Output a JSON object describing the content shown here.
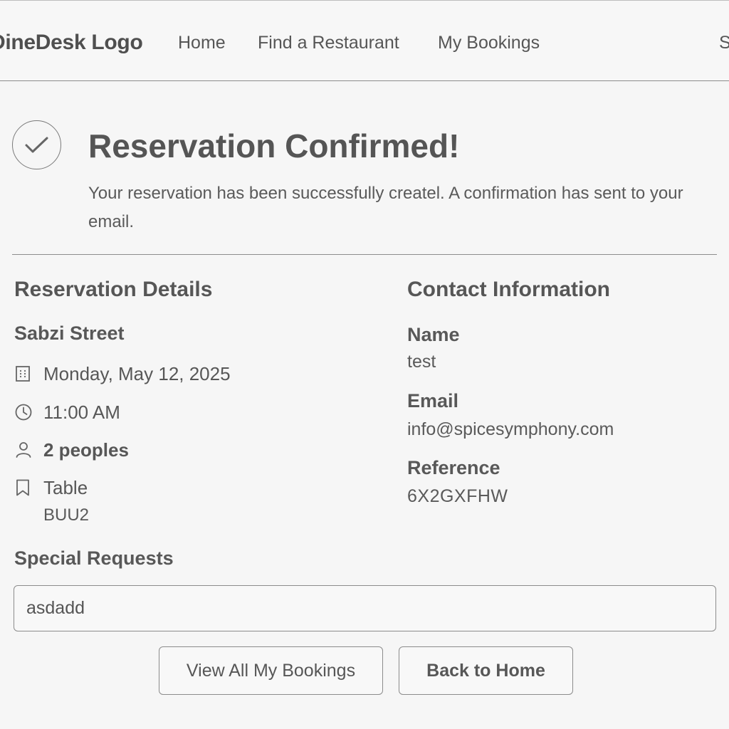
{
  "header": {
    "logo": "DineDesk Logo",
    "nav": {
      "home": "Home",
      "find": "Find a Restaurant",
      "bookings": "My Bookings",
      "edge_partial": "S"
    }
  },
  "confirmation": {
    "title": "Reservation Confirmed!",
    "message": "Your reservation has been successfully createl. A confirmation has sent to your email."
  },
  "reservation": {
    "heading": "Reservation Details",
    "restaurant": "Sabzi Street",
    "date": "Monday, May 12, 2025",
    "time": "11:00 AM",
    "party": "2 peoples",
    "table_label": "Table",
    "table_code": "BUU2"
  },
  "contact": {
    "heading": "Contact Information",
    "name_label": "Name",
    "name_value": "test",
    "email_label": "Email",
    "email_value": "info@spicesymphony.com",
    "reference_label": "Reference",
    "reference_value": "6X2GXFHW"
  },
  "special_requests": {
    "heading": "Special Requests",
    "value": "asdadd"
  },
  "actions": {
    "view_all": "View All My Bookings",
    "back_home": "Back to Home"
  },
  "icons": {
    "check": "check-icon",
    "calendar": "calendar-icon",
    "clock": "clock-icon",
    "person": "person-icon",
    "bookmark": "bookmark-icon"
  }
}
